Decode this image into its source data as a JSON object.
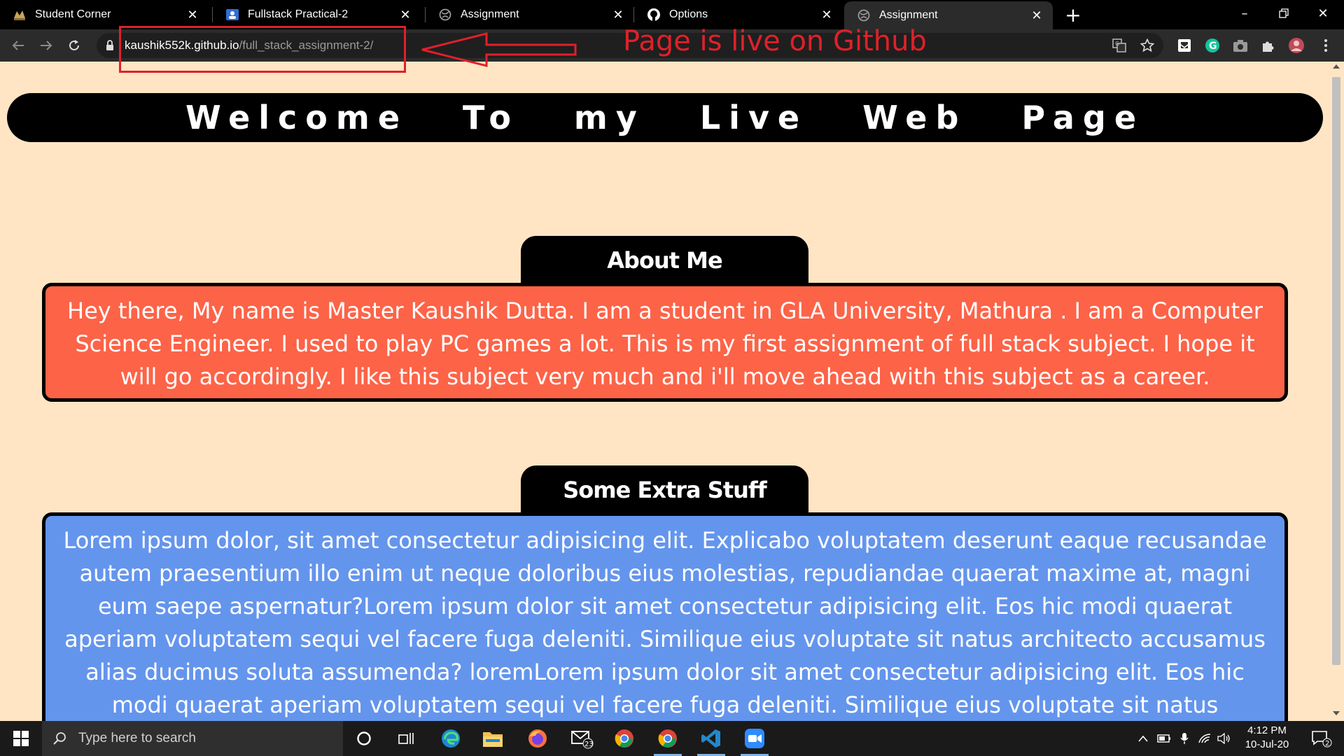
{
  "browser": {
    "tabs": [
      {
        "title": "Student Corner",
        "favicon": "student-corner-favicon"
      },
      {
        "title": "Fullstack Practical-2",
        "favicon": "google-classroom-favicon"
      },
      {
        "title": "Assignment",
        "favicon": "globe-favicon"
      },
      {
        "title": "Options",
        "favicon": "github-favicon"
      },
      {
        "title": "Assignment",
        "favicon": "globe-favicon",
        "active": true
      }
    ],
    "url_host": "kaushik552k.github.io",
    "url_path": "/full_stack_assignment-2/"
  },
  "annotation": {
    "text": "Page is live on Github",
    "color": "#e0202a"
  },
  "page": {
    "welcome": "Welcome To my Live Web Page",
    "about_heading": "About Me",
    "about_text": "Hey there, My name is Master Kaushik Dutta. I am a student in GLA University, Mathura . I am a Computer Science Engineer. I used to play PC games a lot. This is my first assignment of full stack subject. I hope it will go accordingly. I like this subject very much and i'll move ahead with this subject as a career.",
    "extra_heading": "Some Extra Stuff",
    "extra_text": "Lorem ipsum dolor, sit amet consectetur adipisicing elit. Explicabo voluptatem deserunt eaque recusandae autem praesentium illo enim ut neque doloribus eius molestias, repudiandae quaerat maxime at, magni eum saepe aspernatur?Lorem ipsum dolor sit amet consectetur adipisicing elit. Eos hic modi quaerat aperiam voluptatem sequi vel facere fuga deleniti. Similique eius voluptate sit natus architecto accusamus alias ducimus soluta assumenda? loremLorem ipsum dolor sit amet consectetur adipisicing elit. Eos hic modi quaerat aperiam voluptatem sequi vel facere fuga deleniti. Similique eius voluptate sit natus architecto accusamus alias ducimus",
    "colors": {
      "background": "#ffe5c4",
      "about_box": "#fd6347",
      "extra_box": "#6495ed"
    }
  },
  "taskbar": {
    "search_placeholder": "Type here to search",
    "mail_badge": "23",
    "time": "4:12 PM",
    "date": "10-Jul-20",
    "notification_count": "2"
  }
}
